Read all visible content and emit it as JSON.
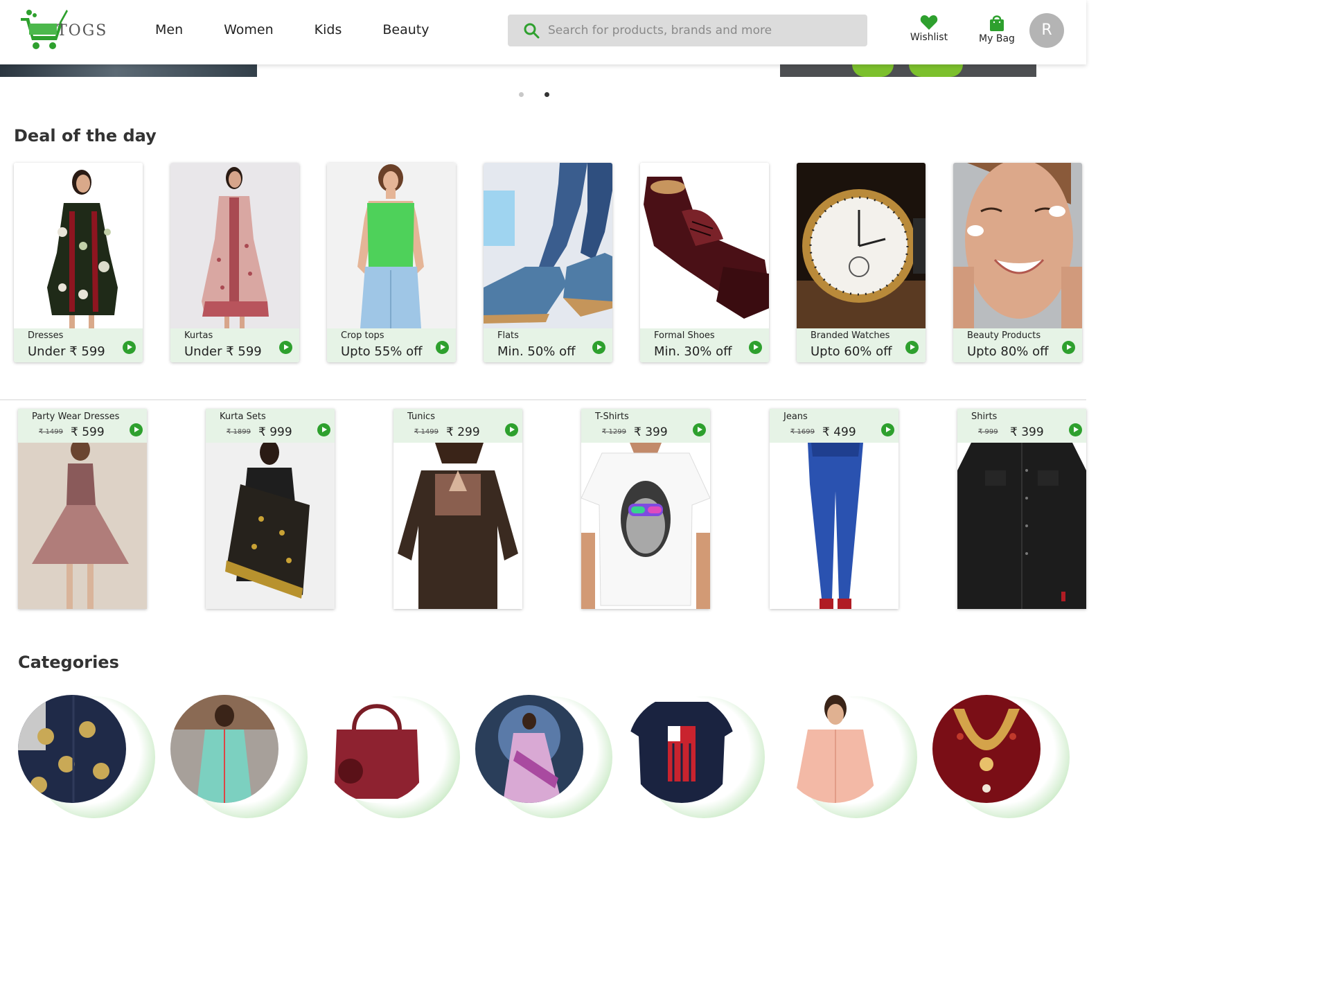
{
  "brand": {
    "name": "TOGS",
    "accent_color": "#2ea02e"
  },
  "nav": [
    "Men",
    "Women",
    "Kids",
    "Beauty"
  ],
  "search": {
    "placeholder": "Search for products, brands and more"
  },
  "header_actions": {
    "wishlist": "Wishlist",
    "bag": "My Bag",
    "avatar_initial": "R"
  },
  "carousel": {
    "slides": 2,
    "active_slide": 2
  },
  "deals": {
    "title": "Deal of the day",
    "items": [
      {
        "name": "Dresses",
        "offer": "Under ₹ 599"
      },
      {
        "name": "Kurtas",
        "offer": "Under ₹ 599"
      },
      {
        "name": "Crop tops",
        "offer": "Upto 55% off"
      },
      {
        "name": "Flats",
        "offer": "Min. 50% off"
      },
      {
        "name": "Formal Shoes",
        "offer": "Min. 30% off"
      },
      {
        "name": "Branded Watches",
        "offer": "Upto 60% off"
      },
      {
        "name": "Beauty Products",
        "offer": "Upto 80% off"
      }
    ]
  },
  "products": [
    {
      "name": "Party Wear Dresses",
      "old_price": "₹ 1499",
      "price": "₹ 599"
    },
    {
      "name": "Kurta Sets",
      "old_price": "₹ 1899",
      "price": "₹ 999"
    },
    {
      "name": "Tunics",
      "old_price": "₹ 1499",
      "price": "₹ 299"
    },
    {
      "name": "T-Shirts",
      "old_price": "₹ 1299",
      "price": "₹ 399"
    },
    {
      "name": "Jeans",
      "old_price": "₹ 1699",
      "price": "₹ 499"
    },
    {
      "name": "Shirts",
      "old_price": "₹ 999",
      "price": "₹ 399"
    }
  ],
  "categories": {
    "title": "Categories"
  }
}
